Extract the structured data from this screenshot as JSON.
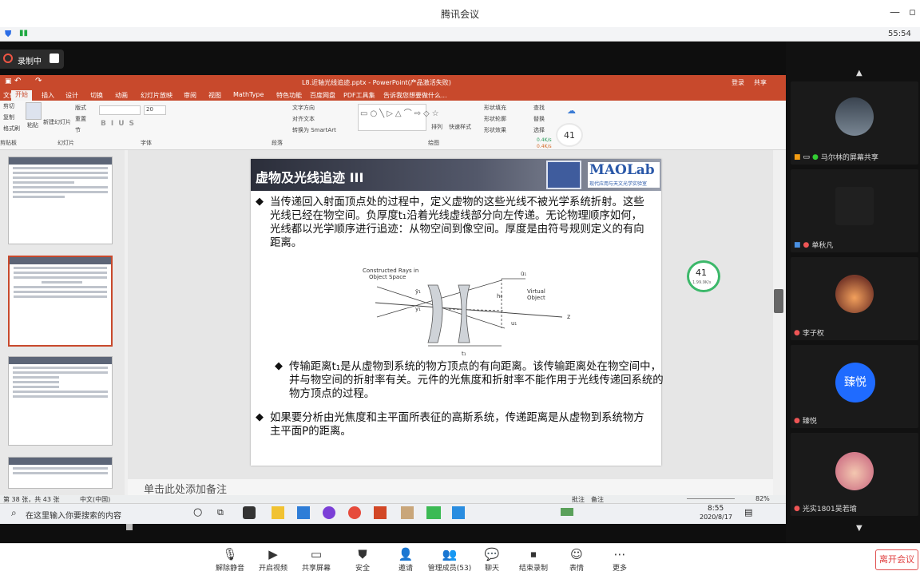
{
  "window": {
    "title": "腾讯会议",
    "clock": "55:54"
  },
  "recording": {
    "label": "录制中"
  },
  "ppt": {
    "doc_title": "L8.近轴光线追迹.pptx - PowerPoint(产品激活失败)",
    "login": "登录",
    "share": "共享",
    "tabs": [
      "文件",
      "开始",
      "插入",
      "设计",
      "切换",
      "动画",
      "幻灯片放映",
      "审阅",
      "视图",
      "MathType",
      "特色功能",
      "百度网盘",
      "PDF工具集"
    ],
    "tell_me": "告诉我您想要做什么...",
    "ribbon": {
      "clipboard": [
        "剪切",
        "复制",
        "格式刷"
      ],
      "paste": "粘贴",
      "new_slide": "新建幻灯片",
      "layout": "版式",
      "reset": "重置",
      "section": "节",
      "groups": [
        "剪贴板",
        "幻灯片",
        "字体",
        "段落",
        "绘图"
      ],
      "paragraph_items": [
        "文字方向",
        "对齐文本",
        "转换为 SmartArt"
      ],
      "arrange": "排列",
      "quick_styles": "快速样式",
      "shape_fill": "形状填充",
      "shape_outline": "形状轮廓",
      "shape_effects": "形状效果",
      "find": "查找",
      "replace": "替换",
      "select": "选择",
      "font_size": "20",
      "meter_percent": "41",
      "meter_up": "0.4K/s",
      "meter_down": "0.4K/s"
    },
    "slide": {
      "title": "虚物及光线追迹 III",
      "brand": "MAOLab",
      "brand_sub": "现代应用与天文光学实验室",
      "para1": "当传递回入射面顶点处的过程中，定义虚物的这些光线不被光学系统折射。这些光线已经在物空间。负厚度t₁沿着光线虚线部分向左传递。无论物理顺序如何，光线都以光学顺序进行追迹：从物空间到像空间。厚度是由符号规则定义的有向距离。",
      "para2": "传输距离t₁是从虚物到系统的物方顶点的有向距离。该传输距离处在物空间中，并与物空间的折射率有关。元件的光焦度和折射率不能作用于光线传递回系统的物方顶点的过程。",
      "para3": "如果要分析由光焦度和主平面所表征的高斯系统，传递距离是从虚物到系统物方主平面P的距离。",
      "diagram": {
        "constructed_rays": "Constructed Rays in",
        "object_space": "Object Space",
        "virtual": "Virtual",
        "object": "Object",
        "u1bar": "ū₁",
        "y1bar": "ȳ₁",
        "y1": "y₁",
        "h0": "h₀",
        "u1": "u₁",
        "z": "z",
        "t1": "t₁"
      },
      "overlay_percent": "41",
      "overlay_speed": "1.99.9K/s"
    },
    "notes_placeholder": "单击此处添加备注",
    "status": {
      "slide_info": "第 38 张，共 43 张",
      "lang": "中文(中国)",
      "notes": "备注",
      "comments": "批注",
      "zoom": "82%"
    },
    "taskbar": {
      "search": "在这里输入你要搜索的内容",
      "time": "8:55",
      "date": "2020/8/17"
    }
  },
  "participants": [
    {
      "name": "马尔林的屏幕共享",
      "kind": "photo"
    },
    {
      "name": "单秋凡",
      "kind": "photo"
    },
    {
      "name": "李子权",
      "kind": "photo"
    },
    {
      "name": "臻悦",
      "kind": "initial",
      "initial": "臻悦"
    },
    {
      "name": "光实1801吴若瑜",
      "kind": "photo"
    }
  ],
  "toolbar": {
    "items": [
      "解除静音",
      "开启视频",
      "共享屏幕",
      "安全",
      "邀请",
      "管理成员(53)",
      "聊天",
      "结束录制",
      "表情",
      "更多"
    ],
    "leave": "离开会议"
  },
  "colors": {
    "ppt_accent": "#c8492c",
    "meeting_blue": "#1f6bff",
    "leave_red": "#e04040"
  }
}
